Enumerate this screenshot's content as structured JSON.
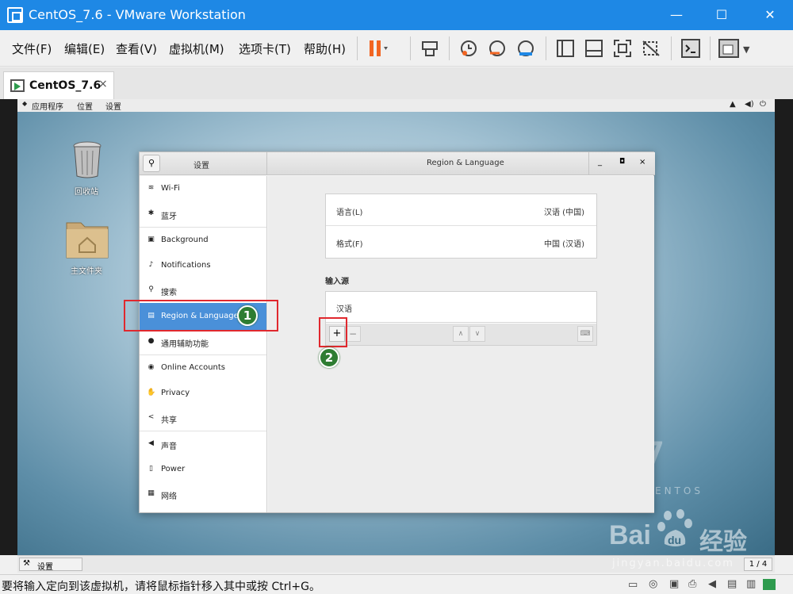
{
  "window": {
    "title": "CentOS_7.6 - VMware Workstation",
    "minimize": "—",
    "maximize": "☐",
    "close": "✕"
  },
  "menubar": {
    "items": [
      "文件(F)",
      "编辑(E)",
      "查看(V)",
      "虚拟机(M)",
      "选项卡(T)",
      "帮助(H)"
    ]
  },
  "tab": {
    "label": "CentOS_7.6",
    "close": "×"
  },
  "gnome_topbar": {
    "apps": "应用程序",
    "places": "位置",
    "settings": "设置"
  },
  "desktop": {
    "trash_label": "回收站",
    "home_label": "主文件夹",
    "logo_number": "7",
    "logo_text": "ENTOS"
  },
  "settings_window": {
    "sidebar_title": "设置",
    "panel_title": "Region & Language",
    "sidebar_items": [
      {
        "label": "Wi-Fi",
        "icon": "wifi-icon",
        "glyph": "≋"
      },
      {
        "label": "蓝牙",
        "icon": "bluetooth-icon",
        "glyph": "✱"
      },
      {
        "label": "Background",
        "icon": "background-icon",
        "glyph": "▣"
      },
      {
        "label": "Notifications",
        "icon": "bell-icon",
        "glyph": "♪"
      },
      {
        "label": "搜索",
        "icon": "search-icon",
        "glyph": "⚲"
      },
      {
        "label": "Region & Language",
        "icon": "region-icon",
        "glyph": "▤"
      },
      {
        "label": "通用辅助功能",
        "icon": "accessibility-icon",
        "glyph": "●"
      },
      {
        "label": "Online Accounts",
        "icon": "online-accounts-icon",
        "glyph": "◉"
      },
      {
        "label": "Privacy",
        "icon": "privacy-icon",
        "glyph": "✋"
      },
      {
        "label": "共享",
        "icon": "share-icon",
        "glyph": "<"
      },
      {
        "label": "声音",
        "icon": "sound-icon",
        "glyph": "◀"
      },
      {
        "label": "Power",
        "icon": "power-icon",
        "glyph": "▯"
      },
      {
        "label": "网络",
        "icon": "network-icon",
        "glyph": "▦"
      }
    ],
    "language_label": "语言(L)",
    "language_value": "汉语 (中国)",
    "formats_label": "格式(F)",
    "formats_value": "中国 (汉语)",
    "input_sources_heading": "输入源",
    "input_source_item": "汉语",
    "add_button": "+",
    "remove_button": "−"
  },
  "annotations": {
    "badge1": "1",
    "badge2": "2"
  },
  "taskbar": {
    "item": "设置",
    "pager": "1 / 4"
  },
  "watermark": {
    "brand": "Bai",
    "brand2": "经验",
    "url": "jingyan.baidu.com"
  },
  "statusbar": {
    "message": "要将输入定向到该虚拟机，请将鼠标指针移入其中或按 Ctrl+G。"
  },
  "colors": {
    "title_bar": "#1e88e5",
    "selected_item": "#4a90d9",
    "annotation_red": "#e0282e",
    "badge_green": "#2e7d32"
  }
}
